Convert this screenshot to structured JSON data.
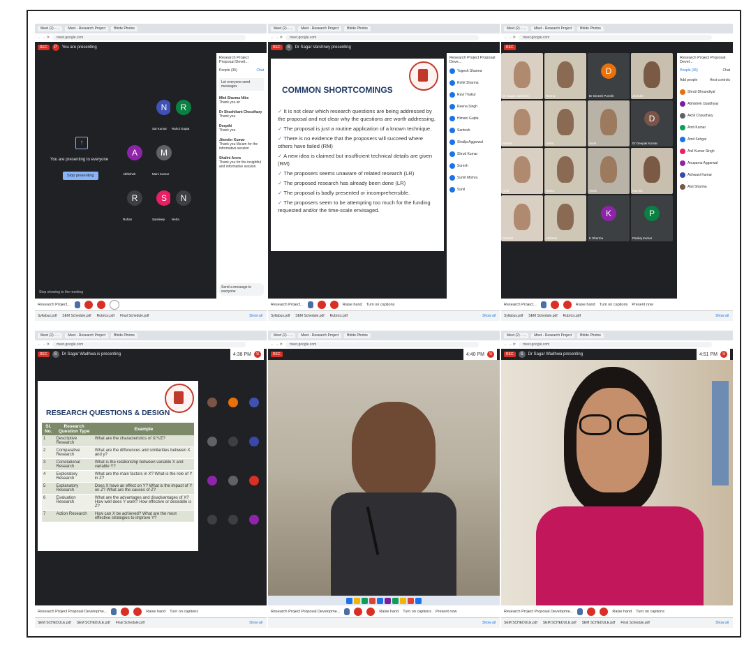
{
  "panels": {
    "p1": {
      "tabs": [
        "Meet (2) - ...",
        "Meet - Research Project",
        "Bhide Photos"
      ],
      "meet_title": "You are presenting",
      "presenting_text": "You are presenting to everyone",
      "stop_button": "Stop presenting",
      "pinned_text": "Stop showing to the meeting",
      "side_header": "Research Project Proposal Devel...",
      "side_tabs": [
        "People (36)",
        "Chat"
      ],
      "chat_toggle": "Let everyone send messages",
      "chat_msgs": [
        {
          "name": "Mhd Sharma Nibs",
          "msg": "Thank you sir"
        },
        {
          "name": "Dr Shashikant Choudhary",
          "msg": "Thank you"
        },
        {
          "name": "Deepthi",
          "msg": "Thank you"
        },
        {
          "name": "Jitender Kumar",
          "msg": "Thank you Ma'am for the informative session"
        },
        {
          "name": "Shalini Arora",
          "msg": "Thank you for the insightful and informative session"
        }
      ],
      "chat_input": "Send a message to everyone",
      "tiles": [
        {
          "letter": "N",
          "color": "#3f51b5",
          "cap": "Sai Kumar"
        },
        {
          "letter": "R",
          "color": "#0b8043",
          "cap": "Rahul Gupta"
        },
        {
          "letter": "A",
          "color": "#8e24aa",
          "cap": "Abhishek"
        },
        {
          "letter": "M",
          "color": "#5f6368",
          "cap": "Mani Kumar"
        },
        {
          "letter": "R",
          "color": "#3c4043",
          "cap": "Rohan"
        },
        {
          "letter": "S",
          "color": "#e91e63",
          "cap": "Sandeep"
        },
        {
          "letter": "N",
          "color": "#3c4043",
          "cap": "Neha"
        }
      ],
      "meeting_name": "Research Project...",
      "downloads": [
        "Syllabus.pdf",
        "SEM Schedule.pdf",
        "Rubrics.pdf",
        "Final Schedule.pdf"
      ],
      "show_all": "Show all"
    },
    "p2": {
      "tabs": [
        "Meet (2) - ...",
        "Meet - Research Project",
        "Bhide Photos"
      ],
      "meet_title": "Dr Sagar Varshney presenting",
      "slide_title": "COMMON SHORTCOMINGS",
      "bullets": [
        "It is not clear which research questions are being addressed by the proposal and not clear why the questions are worth addressing.",
        "The proposal is just a routine application of a known technique.",
        "There is no evidence that the proposers will succeed where others have failed (RM)",
        "A new idea is claimed but insufficient technical details are given (RM)",
        "The proposers seems unaware of related research (LR)",
        "The proposed research has already been done (LR)",
        "The proposal is badly presented or incomprehensible.",
        "The proposers seem to be attempting too much for the funding requested and/or the time-scale envisaged."
      ],
      "side_header": "Research Project Proposal Deve...",
      "people": [
        "Yogesh Sharma",
        "Rohit Sharma",
        "Ravi Thakur",
        "Reena Singh",
        "Himani Gupta",
        "Santosh",
        "Shailja Aggarwal",
        "Shruti Kumar",
        "Suresh",
        "Sumit Mishra",
        "Sunil"
      ],
      "meeting_name": "Research Project...",
      "ctrl_labels": [
        "Raise hand",
        "Turn on captions",
        "Dr Sagar Varshney is presenting"
      ],
      "downloads": [
        "Syllabus.pdf",
        "SEM Schedule.pdf",
        "Rubrics.pdf"
      ],
      "show_all": "Show all"
    },
    "p3": {
      "tabs": [
        "Meet (2) - ...",
        "Meet - Research Project",
        "Bhide Photos"
      ],
      "side_header": "Research Project Proposal Devel...",
      "side_tabs": [
        "People (36)",
        "Chat"
      ],
      "people": [
        "Shruti Dhoundiyal",
        "Abhishek Upadhyay",
        "Akhil Choudhary",
        "Amit Kumar",
        "Amit Sehgal",
        "Anil Kumar Singh",
        "Anupama Aggarwal",
        "Ashwani Kumar",
        "Atul Sharma"
      ],
      "add_people": "Add people",
      "host_controls": "Host controls",
      "tiles": [
        {
          "type": "video",
          "cap": "Dr Sagar Varshney"
        },
        {
          "type": "video",
          "cap": "Reena"
        },
        {
          "type": "letter",
          "letter": "D",
          "color": "#e8710a",
          "cap": "Dr Dinesh Purohit"
        },
        {
          "type": "video",
          "cap": "Jitender"
        },
        {
          "type": "video",
          "cap": "Rajesh"
        },
        {
          "type": "video",
          "cap": "Ankur"
        },
        {
          "type": "video",
          "cap": "Sunil"
        },
        {
          "type": "letter",
          "letter": "D",
          "color": "#795548",
          "cap": "Dr Deepak Kumar"
        },
        {
          "type": "video",
          "cap": "Amit"
        },
        {
          "type": "video",
          "cap": "Rahul"
        },
        {
          "type": "video",
          "cap": "Vivek"
        },
        {
          "type": "video",
          "cap": "Manish"
        },
        {
          "type": "video",
          "cap": "Rakesh"
        },
        {
          "type": "video",
          "cap": "Abhinav"
        },
        {
          "type": "letter",
          "letter": "K",
          "color": "#8e24aa",
          "cap": "K Sharma"
        },
        {
          "type": "letter",
          "letter": "P",
          "color": "#0b8043",
          "cap": "Pankaj Kumar"
        }
      ],
      "meeting_name": "Research Project...",
      "ctrl_labels": [
        "Raise hand",
        "Turn on captions",
        "Present now"
      ],
      "downloads": [
        "Syllabus.pdf",
        "SEM Schedule.pdf",
        "Rubrics.pdf"
      ],
      "show_all": "Show all"
    },
    "p4": {
      "tabs": [
        "Meet (2) - ...",
        "Meet - Research Project",
        "Bhide Photos"
      ],
      "meet_title": "Dr Sagar Wadhwa is presenting",
      "clock": "4:38 PM",
      "slide_title": "RESEARCH QUESTIONS & DESIGN",
      "table_headers": [
        "Sl. No.",
        "Research Question Type",
        "Example"
      ],
      "table_rows": [
        [
          "1",
          "Descriptive Research",
          "What are the characteristics of X/Y/Z?"
        ],
        [
          "2",
          "Comparative Research",
          "What are the differences and similarities between X and y?"
        ],
        [
          "3",
          "Correlational Research",
          "What is the relationship between variable X and variable Y?"
        ],
        [
          "4",
          "Exploratory Research",
          "What are the main factors in X? What is the role of Y in Z?"
        ],
        [
          "5",
          "Explanatory Research",
          "Does X have an effect on Y? What is the impact of Y on Z? What are the causes of Z?"
        ],
        [
          "6",
          "Evaluation Research",
          "What are the advantages and disadvantages of X? How well does Y work? How effective or desirable is Z?"
        ],
        [
          "7",
          "Action Research",
          "How can X be achieved? What are the most effective strategies to improve Y?"
        ]
      ],
      "meeting_name": "Research Project Proposal Developme...",
      "ctrl_labels": [
        "Raise hand",
        "Turn on captions",
        "Dr Sagar Wadhwa is presenting"
      ],
      "downloads": [
        "SEM SCHEDULE.pdf",
        "SEM SCHEDULE.pdf",
        "Final Schedule.pdf"
      ],
      "show_all": "Show all"
    },
    "p5": {
      "tabs": [
        "Meet (2) - ...",
        "Meet - Research Project",
        "Bhide Photos"
      ],
      "clock": "4:40 PM",
      "meeting_name": "Research Project Proposal Developme...",
      "ctrl_labels": [
        "Raise hand",
        "Turn on captions",
        "Present now"
      ],
      "show_all": "Show all"
    },
    "p6": {
      "tabs": [
        "Meet (2) - ...",
        "Meet - Research Project",
        "Bhide Photos"
      ],
      "meet_title": "Dr Sagar Wadhwa presenting",
      "clock": "4:51 PM",
      "meeting_name": "Research Project Proposal Developme...",
      "ctrl_labels": [
        "Raise hand",
        "Turn on captions",
        "Dr Sagar Wadhwa is presenting"
      ],
      "downloads": [
        "SEM SCHEDULE.pdf",
        "SEM SCHEDULE.pdf",
        "SEM SCHEDULE.pdf",
        "Final Schedule.pdf"
      ],
      "show_all": "Show all"
    }
  }
}
